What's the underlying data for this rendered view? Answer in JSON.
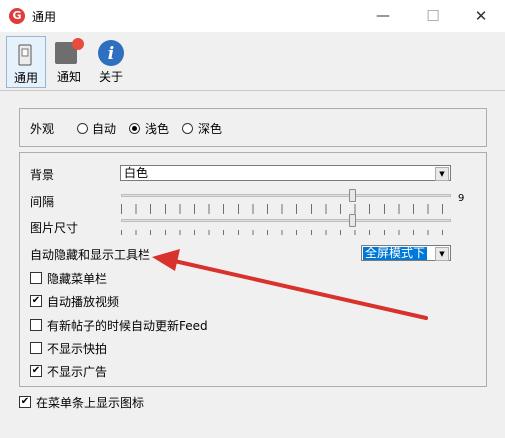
{
  "window": {
    "title": "通用",
    "logo_letter": "G",
    "min": "—",
    "max": "☐",
    "close": "✕"
  },
  "toolbar": {
    "items": [
      {
        "label": "通用",
        "icon": "general-icon",
        "selected": true
      },
      {
        "label": "通知",
        "icon": "notification-icon"
      },
      {
        "label": "关于",
        "icon": "about-icon"
      }
    ]
  },
  "appearance": {
    "label": "外观",
    "options": [
      "自动",
      "浅色",
      "深色"
    ],
    "selected": "浅色"
  },
  "settings": {
    "background_label": "背景",
    "background_value": "白色",
    "spacing_label": "间隔",
    "spacing_value": "9",
    "spacing_level": 0.7,
    "image_size_label": "图片尺寸",
    "image_size_level": 0.7,
    "auto_hide_label": "自动隐藏和显示工具栏",
    "auto_hide_value": "全屏模式下",
    "checkboxes": [
      {
        "label": "隐藏菜单栏",
        "checked": false
      },
      {
        "label": "自动播放视频",
        "checked": true
      },
      {
        "label": "有新帖子的时候自动更新Feed",
        "checked": false
      },
      {
        "label": "不显示快拍",
        "checked": false
      },
      {
        "label": "不显示广告",
        "checked": true
      }
    ]
  },
  "menubar_icon": {
    "label": "在菜单条上显示图标",
    "checked": true
  },
  "colors": {
    "annotation_arrow": "#d9312b",
    "selection": "#0078d7",
    "notify_dot": "#e74c3c"
  },
  "check_glyph": "✔"
}
